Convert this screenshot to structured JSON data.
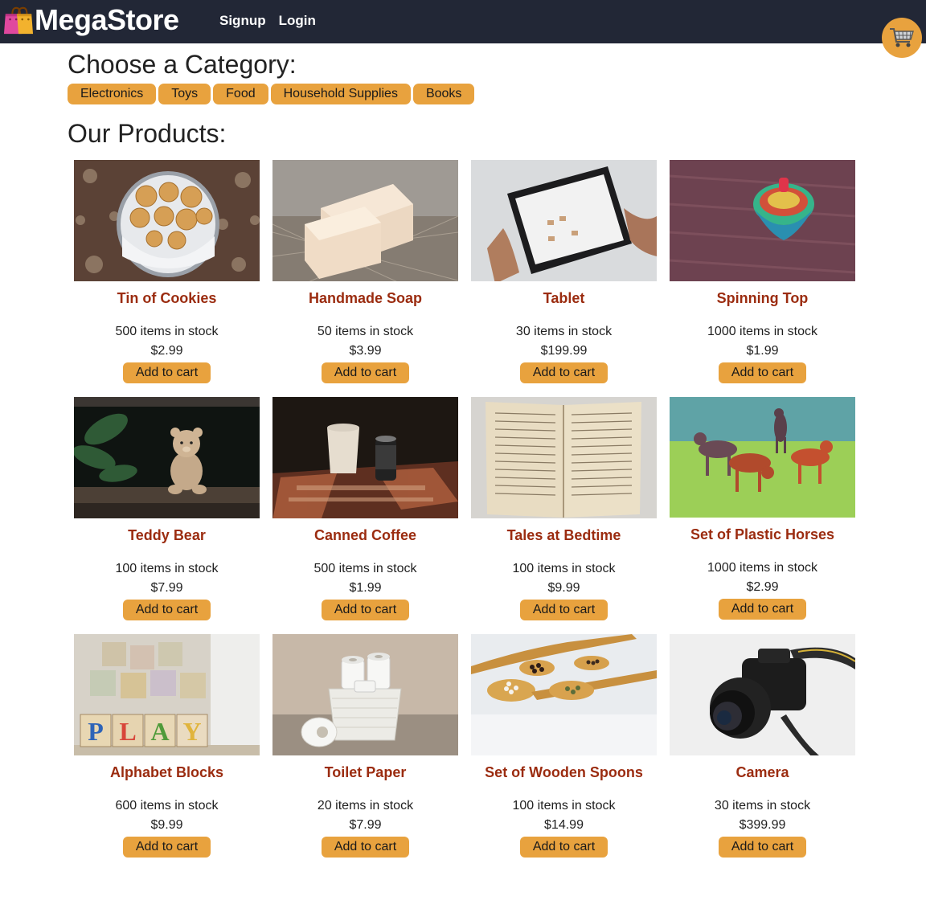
{
  "header": {
    "brand": "MegaStore",
    "nav": [
      {
        "label": "Signup"
      },
      {
        "label": "Login"
      }
    ]
  },
  "categories": {
    "heading": "Choose a Category:",
    "items": [
      {
        "label": "Electronics"
      },
      {
        "label": "Toys"
      },
      {
        "label": "Food"
      },
      {
        "label": "Household Supplies"
      },
      {
        "label": "Books"
      }
    ]
  },
  "products": {
    "heading": "Our Products:",
    "add_label": "Add to cart",
    "items": [
      {
        "name": "Tin of Cookies",
        "stock": "500 items in stock",
        "price": "$2.99",
        "image": "cookies-photo"
      },
      {
        "name": "Handmade Soap",
        "stock": "50 items in stock",
        "price": "$3.99",
        "image": "soap-photo"
      },
      {
        "name": "Tablet",
        "stock": "30 items in stock",
        "price": "$199.99",
        "image": "tablet-photo"
      },
      {
        "name": "Spinning Top",
        "stock": "1000 items in stock",
        "price": "$1.99",
        "image": "spinning-top-photo"
      },
      {
        "name": "Teddy Bear",
        "stock": "100 items in stock",
        "price": "$7.99",
        "image": "teddy-bear-photo"
      },
      {
        "name": "Canned Coffee",
        "stock": "500 items in stock",
        "price": "$1.99",
        "image": "canned-coffee-photo"
      },
      {
        "name": "Tales at Bedtime",
        "stock": "100 items in stock",
        "price": "$9.99",
        "image": "book-photo"
      },
      {
        "name": "Set of Plastic Horses",
        "stock": "1000 items in stock",
        "price": "$2.99",
        "image": "plastic-horses-photo"
      },
      {
        "name": "Alphabet Blocks",
        "stock": "600 items in stock",
        "price": "$9.99",
        "image": "alphabet-blocks-photo"
      },
      {
        "name": "Toilet Paper",
        "stock": "20 items in stock",
        "price": "$7.99",
        "image": "toilet-paper-photo"
      },
      {
        "name": "Set of Wooden Spoons",
        "stock": "100 items in stock",
        "price": "$14.99",
        "image": "wooden-spoons-photo"
      },
      {
        "name": "Camera",
        "stock": "30 items in stock",
        "price": "$399.99",
        "image": "camera-photo"
      }
    ]
  },
  "colors": {
    "header_bg": "#222736",
    "accent": "#e8a23e",
    "product_name": "#9b2c10"
  }
}
